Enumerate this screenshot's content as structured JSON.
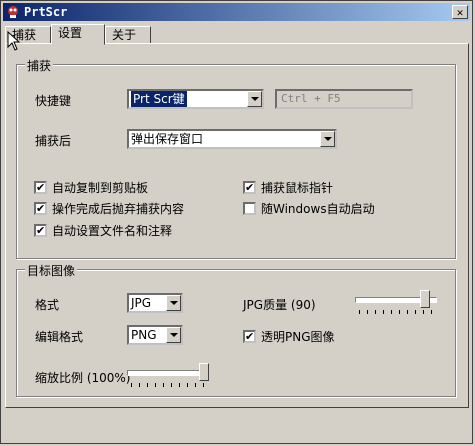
{
  "window": {
    "title": "PrtScr",
    "close_label": "✕"
  },
  "tabs": [
    {
      "label": "捕获",
      "active": false
    },
    {
      "label": "设置",
      "active": true
    },
    {
      "label": "关于",
      "active": false
    }
  ],
  "capture_group": {
    "title": "捕获",
    "hotkey_label": "快捷键",
    "hotkey_value": "Prt Scr键",
    "hotkey_alt": "Ctrl + F5",
    "after_label": "捕获后",
    "after_value": "弹出保存窗口",
    "options": [
      {
        "label": "自动复制到剪贴板",
        "checked": true
      },
      {
        "label": "操作完成后抛弃捕获内容",
        "checked": true
      },
      {
        "label": "自动设置文件名和注释",
        "checked": true
      },
      {
        "label": "捕获鼠标指针",
        "checked": true
      },
      {
        "label": "随Windows自动启动",
        "checked": false
      }
    ]
  },
  "image_group": {
    "title": "目标图像",
    "format_label": "格式",
    "format_value": "JPG",
    "edit_format_label": "编辑格式",
    "edit_format_value": "PNG",
    "quality_label": "JPG质量 (90)",
    "quality_value": 90,
    "transparent_png_label": "透明PNG图像",
    "transparent_png_checked": true,
    "scale_label": "缩放比例 (100%)",
    "scale_value": 100
  },
  "colors": {
    "titlebar_start": "#0a246a",
    "titlebar_end": "#a6caf0",
    "face": "#d4d0c8"
  }
}
